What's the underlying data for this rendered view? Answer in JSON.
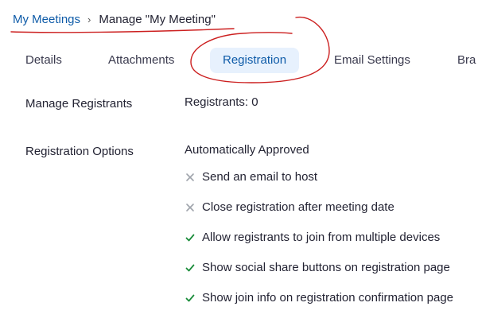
{
  "breadcrumb": {
    "parent": "My Meetings",
    "separator": "›",
    "current": "Manage \"My Meeting\""
  },
  "tabs": [
    {
      "label": "Details",
      "active": false
    },
    {
      "label": "Attachments",
      "active": false
    },
    {
      "label": "Registration",
      "active": true
    },
    {
      "label": "Email Settings",
      "active": false
    },
    {
      "label": "Bra",
      "active": false
    }
  ],
  "manage_registrants": {
    "label": "Manage Registrants",
    "value": "Registrants: 0"
  },
  "registration_options": {
    "label": "Registration Options",
    "approval": "Automatically Approved",
    "options": [
      {
        "text": "Send an email to host",
        "enabled": false,
        "icon": "cross-icon"
      },
      {
        "text": "Close registration after meeting date",
        "enabled": false,
        "icon": "cross-icon"
      },
      {
        "text": "Allow registrants to join from multiple devices",
        "enabled": true,
        "icon": "check-icon"
      },
      {
        "text": "Show social share buttons on registration page",
        "enabled": true,
        "icon": "check-icon"
      },
      {
        "text": "Show join info on registration confirmation page",
        "enabled": true,
        "icon": "check-icon"
      }
    ]
  },
  "colors": {
    "link": "#0e5ba8",
    "active_tab_bg": "#e7f1fd",
    "check": "#1a8c3a",
    "cross": "#a0a4ac",
    "annotation": "#cc1f1f"
  }
}
